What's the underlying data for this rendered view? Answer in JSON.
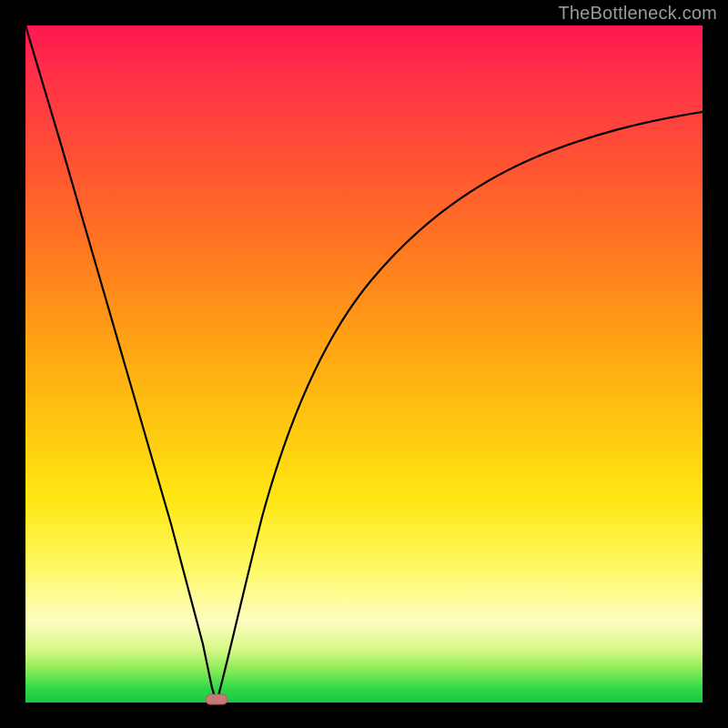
{
  "watermark": "TheBottleneck.com",
  "chart_data": {
    "type": "line",
    "title": "",
    "xlabel": "",
    "ylabel": "",
    "xlim": [
      0,
      100
    ],
    "ylim": [
      0,
      100
    ],
    "grid": false,
    "legend": false,
    "series": [
      {
        "name": "bottleneck-curve",
        "x": [
          0,
          5,
          10,
          15,
          20,
          25,
          27,
          30,
          35,
          40,
          45,
          50,
          55,
          60,
          65,
          70,
          75,
          80,
          85,
          90,
          95,
          100
        ],
        "values": [
          100,
          82,
          63,
          45,
          26,
          8,
          0,
          10,
          28,
          42,
          53,
          61,
          68,
          73,
          77,
          80,
          82,
          84,
          85.5,
          86.5,
          87.3,
          88
        ]
      }
    ],
    "marker": {
      "name": "optimum-marker",
      "x": 27,
      "y": 0,
      "color": "#c37b78"
    },
    "background_gradient": [
      "#ff1750",
      "#ff7a20",
      "#ffe713",
      "#fdfdc1",
      "#17c845"
    ]
  }
}
